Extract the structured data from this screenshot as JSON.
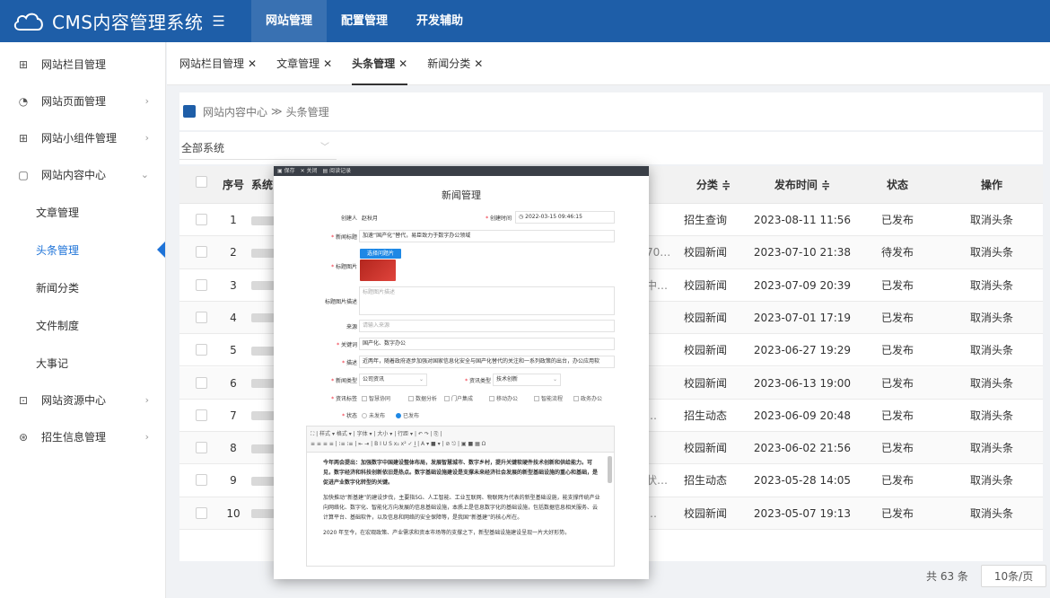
{
  "app": {
    "title": "CMS内容管理系统"
  },
  "topnav": [
    "网站管理",
    "配置管理",
    "开发辅助"
  ],
  "sidebar": {
    "items": [
      {
        "label": "网站栏目管理",
        "icon": "grid-icon"
      },
      {
        "label": "网站页面管理",
        "icon": "page-icon"
      },
      {
        "label": "网站小组件管理",
        "icon": "widget-icon"
      },
      {
        "label": "网站内容中心",
        "icon": "content-icon"
      }
    ],
    "subitems": [
      "文章管理",
      "头条管理",
      "新闻分类",
      "文件制度",
      "大事记"
    ],
    "items_bottom": [
      {
        "label": "网站资源中心",
        "icon": "resource-icon"
      },
      {
        "label": "招生信息管理",
        "icon": "admission-icon"
      }
    ]
  },
  "tabs": [
    "网站栏目管理",
    "文章管理",
    "头条管理",
    "新闻分类"
  ],
  "breadcrumb": {
    "root": "网站内容中心",
    "sep": "≫",
    "current": "头条管理"
  },
  "filter": {
    "system_select": "全部系统"
  },
  "table": {
    "headers": {
      "index": "序号",
      "system": "系统",
      "category": "分类 ≑",
      "time": "发布时间 ≑",
      "status": "状态",
      "action": "操作"
    },
    "rows": [
      {
        "no": "1",
        "frag": "",
        "category": "招生查询",
        "time": "2023-08-11 11:56",
        "status": "已发布",
        "action": "取消头条"
      },
      {
        "no": "2",
        "frag": "70…",
        "category": "校园新闻",
        "time": "2023-07-10 21:38",
        "status": "待发布",
        "action": "取消头条"
      },
      {
        "no": "3",
        "frag": "中…",
        "category": "校园新闻",
        "time": "2023-07-09 20:39",
        "status": "已发布",
        "action": "取消头条"
      },
      {
        "no": "4",
        "frag": "",
        "category": "校园新闻",
        "time": "2023-07-01 17:19",
        "status": "已发布",
        "action": "取消头条"
      },
      {
        "no": "5",
        "frag": "",
        "category": "校园新闻",
        "time": "2023-06-27 19:29",
        "status": "已发布",
        "action": "取消头条"
      },
      {
        "no": "6",
        "frag": "",
        "category": "校园新闻",
        "time": "2023-06-13 19:00",
        "status": "已发布",
        "action": "取消头条"
      },
      {
        "no": "7",
        "frag": "…",
        "category": "招生动态",
        "time": "2023-06-09 20:48",
        "status": "已发布",
        "action": "取消头条"
      },
      {
        "no": "8",
        "frag": "",
        "category": "校园新闻",
        "time": "2023-06-02 21:56",
        "status": "已发布",
        "action": "取消头条"
      },
      {
        "no": "9",
        "frag": "状…",
        "category": "招生动态",
        "time": "2023-05-28 14:05",
        "status": "已发布",
        "action": "取消头条"
      },
      {
        "no": "10",
        "frag": "…",
        "category": "校园新闻",
        "time": "2023-05-07 19:13",
        "status": "已发布",
        "action": "取消头条"
      }
    ]
  },
  "pager": {
    "total": "共 63 条",
    "size": "10条/页"
  },
  "modal": {
    "toolbar": [
      "保存",
      "关闭",
      "阅读记录"
    ],
    "title": "新闻管理",
    "creator_label": "创建人",
    "creator": "赵秋月",
    "created_label": "创建时间",
    "created": "2022-03-15 09:46:15",
    "headline_label": "新闻标题",
    "headline": "加速“国产化”替代，易臣致力于数字办公领域",
    "image_label": "标题图片",
    "image_button": "选择问题片",
    "image_desc_label": "标题图片描述",
    "image_desc_placeholder": "标题图片描述",
    "source_label": "来源",
    "source_placeholder": "请输入来源",
    "keywords_label": "关键词",
    "keywords": "国产化、数字办公",
    "desc_label": "描述",
    "desc": "近两年，随着政府逐步加强对国家信息化安全与国产化替代的关注和一系列政策的出台，办公应用软",
    "news_type_label": "新闻类型",
    "news_type": "公司资讯",
    "info_type_label": "资讯类型",
    "info_type": "技术创新",
    "tags_label": "资讯标签",
    "tags": [
      "智慧协同",
      "数据分析",
      "门户集成",
      "移动办公",
      "智能流程",
      "政务办公"
    ],
    "status_label": "状态",
    "status_options": [
      "未发布",
      "已发布"
    ],
    "editor_toolbar_1": "⛶ | 样式 ▾ 格式 ▾ | 字体 ▾ | 大小 ▾ | 行距 ▾ | ↶ ↷ | ⎘ |",
    "editor_toolbar_2": "≡ ≡ ≡ ≡ | ⁝≡ ⁝≡ | ⇤ ⇥ | B I U S x₂ x² ✓ I̲ | A ▾ ■ ▾ | ⊘ ⎋ | ▣ ■ ▦ Ω",
    "editor_paragraphs": [
      "今年两会提出：加强数字中国建设整体布局，发展智慧城市、数字乡村，提升关键软硬件技术创新和供给能力。可见，数字经济和科技创新依旧是热点。数字基础设施建设是支撑未来经济社会发展的新型基础设施的重心和基础，是促进产业数字化转型的关键。",
      "加快推动“新基建”的建设步伐，主要指5G、人工智能、工业互联网、物联网为代表的新型基础设施，能支撑传统产业向网络化、数字化、智能化方向发展的信息基础设施，本质上是信息数字化的基础设施，包括数据信息相关服务、云计算平台、基础软件，以及信息和网络的安全保障等，是我国“新基建”的核心所在。",
      "2020 年至今，在宏观政策、产业需求和资本市场等的支撑之下，新型基础设施建设呈现一片大好形势。"
    ]
  }
}
